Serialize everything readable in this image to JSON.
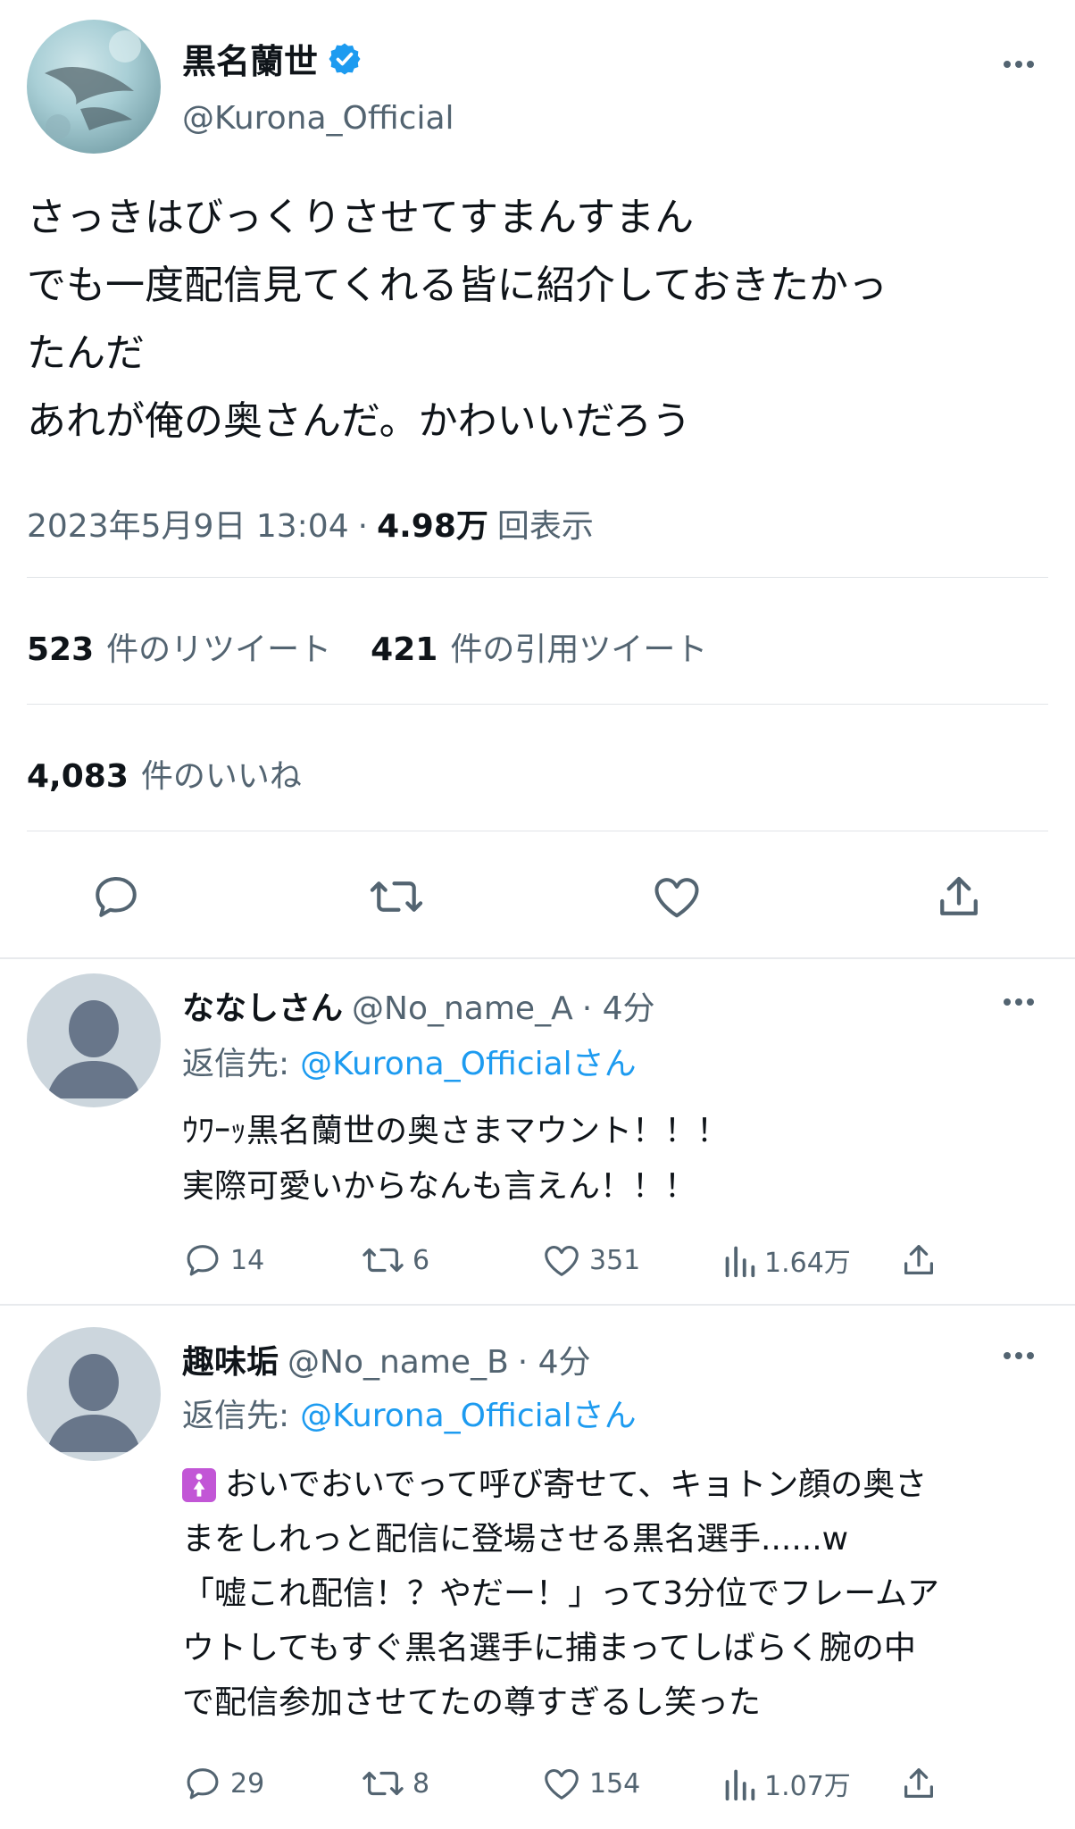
{
  "main_tweet": {
    "author_name": "黒名蘭世",
    "handle": "@Kurona_Official",
    "text_lines": [
      "さっきはびっくりさせてすまんすまん",
      "でも一度配信見てくれる皆に紹介しておきたかっ",
      "たんだ",
      "あれが俺の奥さんだ。かわいいだろう"
    ],
    "timestamp": "2023年5月9日 13:04",
    "dot": "·",
    "views_count": "4.98万",
    "views_label": "回表示",
    "retweets_count": "523",
    "retweets_label": "件のリツイート",
    "quotes_count": "421",
    "quotes_label": "件の引用ツイート",
    "likes_count": "4,083",
    "likes_label": "件のいいね"
  },
  "replies": [
    {
      "name": "ななしさん",
      "handle": "@No_name_A",
      "time": "· 4分",
      "reply_to_label": "返信先:",
      "reply_to_handle": "@Kurona_Officialさん",
      "text_lines": [
        "ｳﾜｰｯ黒名蘭世の奥さまマウント！！！",
        "実際可愛いからなんも言えん！！！"
      ],
      "replies": "14",
      "retweets": "6",
      "likes": "351",
      "views": "1.64万"
    },
    {
      "name": "趣味垢",
      "handle": "@No_name_B",
      "time": "· 4分",
      "reply_to_label": "返信先:",
      "reply_to_handle": "@Kurona_Officialさん",
      "emoji": "🚺",
      "text_lines": [
        "おいでおいでって呼び寄せて、キョトン顔の奥さ",
        "まをしれっと配信に登場させる黒名選手......w",
        "「嘘これ配信！？やだー！」って3分位でフレームア",
        "ウトしてもすぐ黒名選手に捕まってしばらく腕の中",
        "で配信参加させてたの尊すぎるし笑った"
      ],
      "replies": "29",
      "retweets": "8",
      "likes": "154",
      "views": "1.07万"
    }
  ],
  "icons": {
    "verified": "verified-badge-icon",
    "reply": "speech-bubble-icon",
    "retweet": "retweet-arrows-icon",
    "like": "heart-outline-icon",
    "share": "upload-arrow-icon",
    "views": "bar-chart-icon",
    "more": "three-dots-icon",
    "avatar_default": "default-person-icon"
  },
  "colors": {
    "accent": "#1d9bf0",
    "text": "#0f1419",
    "secondary": "#536471"
  }
}
